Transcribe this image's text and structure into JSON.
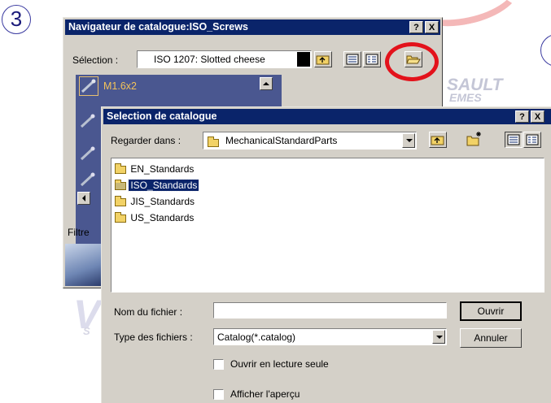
{
  "step_number": "3",
  "watermark": {
    "line1": "SAULT",
    "line2": "EMES"
  },
  "back_window": {
    "title": "Navigateur de catalogue:ISO_Screws",
    "help_btn": "?",
    "close_btn": "X",
    "selection_label": "Sélection :",
    "selection_value": "ISO 1207: Slotted cheese",
    "list_item": "M1.6x2",
    "filter_label": "Filtre"
  },
  "dialog": {
    "title": "Selection de catalogue",
    "help_btn": "?",
    "close_btn": "X",
    "look_in_label": "Regarder dans :",
    "look_in_value": "MechanicalStandardParts",
    "folders": [
      {
        "name": "EN_Standards",
        "selected": false
      },
      {
        "name": "ISO_Standards",
        "selected": true
      },
      {
        "name": "JIS_Standards",
        "selected": false
      },
      {
        "name": "US_Standards",
        "selected": false
      }
    ],
    "filename_label": "Nom du fichier :",
    "filename_value": "",
    "filetype_label": "Type des fichiers :",
    "filetype_value": "Catalog(*.catalog)",
    "open_button": "Ouvrir",
    "cancel_button": "Annuler",
    "readonly_checkbox": "Ouvrir en lecture seule",
    "preview_checkbox": "Afficher l'aperçu"
  },
  "colors": {
    "title_bar": "#0a246a",
    "highlight_ring": "#e3121b",
    "list_bg": "#4a5790"
  }
}
